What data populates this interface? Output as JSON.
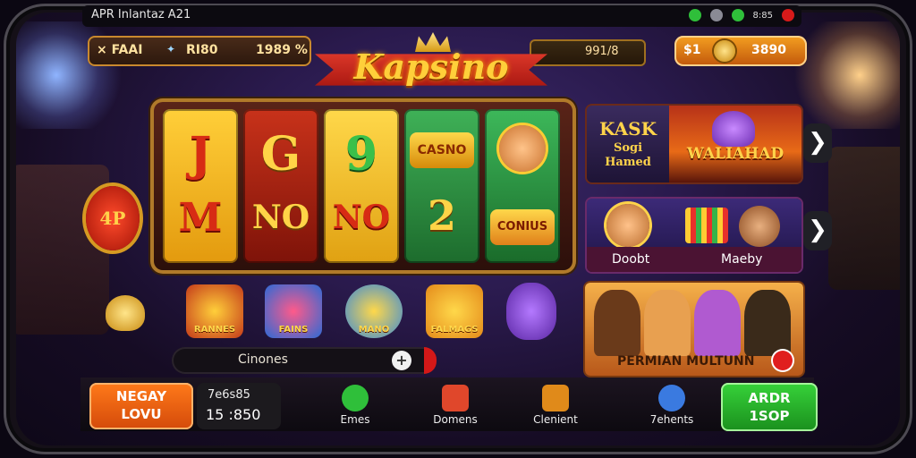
{
  "status_bar": {
    "title": "APR Inlantaz A21",
    "signal": "8:85"
  },
  "top_bar": {
    "left_items": [
      "× FAAI",
      "RI80",
      "1989 %"
    ],
    "mid_value": "991/8",
    "right_value_1": "$1",
    "right_value_2": "3890"
  },
  "logo": {
    "text": "Kapsino"
  },
  "reels": [
    {
      "top": "J",
      "bottom": "M"
    },
    {
      "top": "G",
      "bottom": "NO"
    },
    {
      "top": "9",
      "bottom": "NO"
    },
    {
      "top": "CASNO",
      "bottom": "2"
    },
    {
      "top": "",
      "bottom": "CONIUS"
    }
  ],
  "side_badge": "4P",
  "game_icons": [
    {
      "label": "RANNES",
      "color": "#c43a1a"
    },
    {
      "label": "FAINS",
      "color": "#2b6ad6"
    },
    {
      "label": "MANO",
      "color": "#3a8ad8"
    },
    {
      "label": "FALMAGS",
      "color": "#e48a1a"
    }
  ],
  "search": {
    "placeholder": "Cinones",
    "plus": "+"
  },
  "promo_panels": [
    {
      "left_title": "KASK",
      "left_lines": [
        "Sogi",
        "Hamed"
      ],
      "right_title": "WALIAHAD"
    },
    {
      "left_label": "Doobt",
      "right_label": "Maeby"
    },
    {
      "title": "PERMIAN MULTUNN"
    }
  ],
  "arrows": [
    "❯",
    "❯"
  ],
  "bottom": {
    "orange_button": [
      "NEGAY",
      "LOVU"
    ],
    "stat_label": "7e6s85",
    "stat_value": "15 :850",
    "nav": [
      {
        "label": "Emes",
        "color": "#2fbf3a"
      },
      {
        "label": "Domens",
        "color": "#e0472b"
      },
      {
        "label": "Clenient",
        "color": "#e08a1a"
      },
      {
        "label": "7ehents",
        "color": "#3a7ae0"
      }
    ],
    "green_button": [
      "ARDR",
      "1SOP"
    ]
  }
}
